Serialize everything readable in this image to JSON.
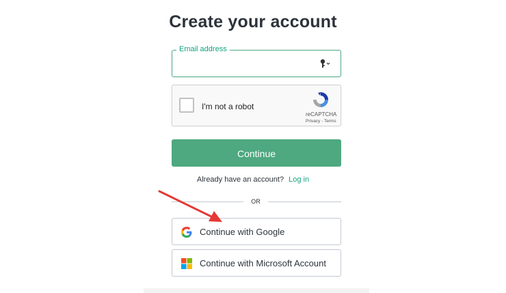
{
  "page": {
    "title": "Create your account"
  },
  "email": {
    "label": "Email address",
    "value": "",
    "placeholder": ""
  },
  "captcha": {
    "label": "I'm not a robot",
    "brand": "reCAPTCHA",
    "links": "Privacy - Terms"
  },
  "continue_button": {
    "label": "Continue"
  },
  "login": {
    "prompt": "Already have an account?",
    "link": "Log in"
  },
  "divider": {
    "text": "OR"
  },
  "social": {
    "google": {
      "label": "Continue with Google",
      "icon": "google-logo-icon"
    },
    "microsoft": {
      "label": "Continue with Microsoft Account",
      "icon": "microsoft-logo-icon"
    }
  },
  "colors": {
    "accent": "#10a37f",
    "button": "#4ea880",
    "border": "#c2c8d0",
    "arrow": "#e53935"
  }
}
